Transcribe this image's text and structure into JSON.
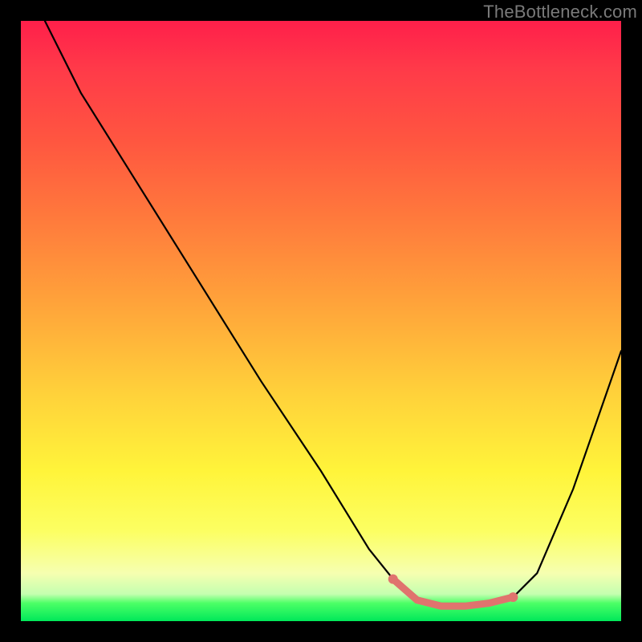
{
  "watermark": "TheBottleneck.com",
  "chart_data": {
    "type": "line",
    "title": "",
    "xlabel": "",
    "ylabel": "",
    "xlim": [
      0,
      100
    ],
    "ylim": [
      0,
      100
    ],
    "series": [
      {
        "name": "bottleneck-curve",
        "x": [
          4,
          10,
          20,
          30,
          40,
          50,
          58,
          62,
          66,
          70,
          74,
          78,
          82,
          86,
          92,
          100
        ],
        "y": [
          100,
          88,
          72,
          56,
          40,
          25,
          12,
          7,
          3.5,
          2.5,
          2.5,
          3,
          4,
          8,
          22,
          45
        ]
      }
    ],
    "highlight_segment": {
      "name": "flat-minimum",
      "color": "#e0736e",
      "x": [
        62,
        66,
        70,
        74,
        78,
        82
      ],
      "y": [
        7,
        3.5,
        2.5,
        2.5,
        3,
        4
      ]
    },
    "gradient_stops": [
      {
        "pos": 0.0,
        "color": "#ff1f4a"
      },
      {
        "pos": 0.33,
        "color": "#ff7a3c"
      },
      {
        "pos": 0.62,
        "color": "#ffd13a"
      },
      {
        "pos": 0.92,
        "color": "#f6ffb0"
      },
      {
        "pos": 1.0,
        "color": "#00e85a"
      }
    ]
  }
}
